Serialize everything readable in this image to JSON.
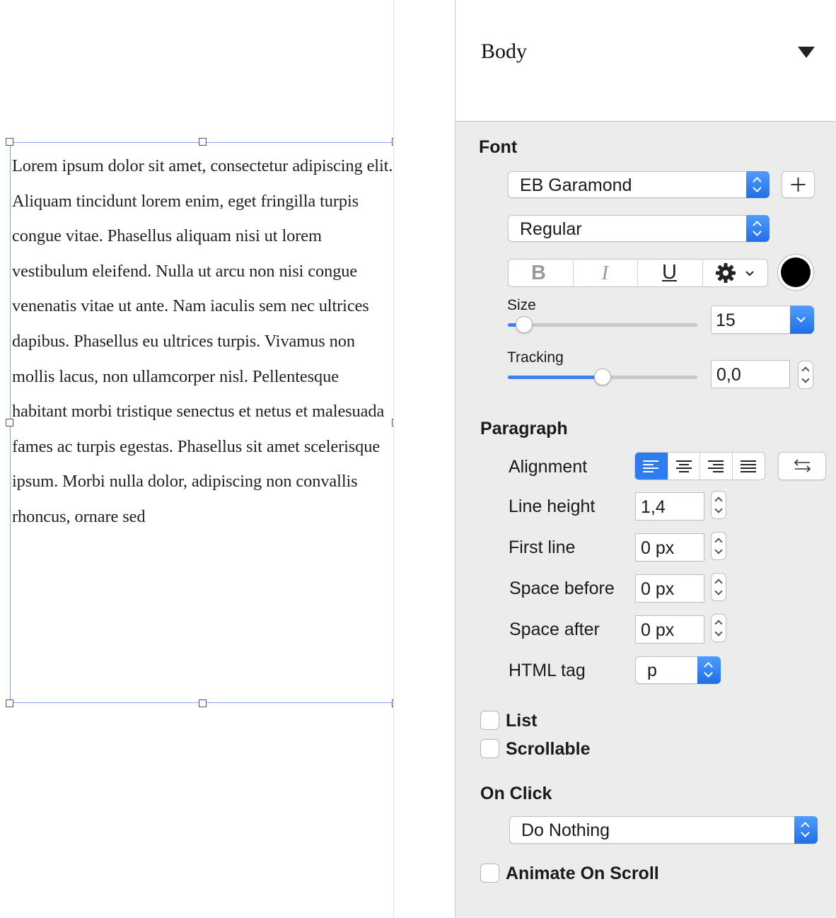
{
  "canvas": {
    "text": "Lorem ipsum dolor sit amet, consectetur adipiscing elit. Aliquam tincidunt lorem enim, eget fringilla turpis congue vitae. Phasellus aliquam nisi ut lorem vestibulum eleifend. Nulla ut arcu non nisi congue venenatis vitae ut ante. Nam iaculis sem nec ultrices dapibus. Phasellus eu ultrices turpis. Vivamus non mollis lacus, non ullamcorper nisl. Pellentesque habitant morbi tristique senectus et netus et malesuada fames ac turpis egestas. Phasellus sit amet scelerisque ipsum. Morbi nulla dolor, adipiscing non convallis rhoncus, ornare sed"
  },
  "inspector": {
    "style_name": "Body",
    "font": {
      "title": "Font",
      "family": "EB Garamond",
      "weight": "Regular",
      "bold_label": "B",
      "italic_label": "I",
      "underline_label": "U",
      "color": "#000000",
      "size_label": "Size",
      "size_value": "15",
      "size_slider_fraction": 0.09,
      "tracking_label": "Tracking",
      "tracking_value": "0,0",
      "tracking_slider_fraction": 0.5
    },
    "paragraph": {
      "title": "Paragraph",
      "alignment_label": "Alignment",
      "alignment_selected": "left",
      "line_height_label": "Line height",
      "line_height_value": "1,4",
      "first_line_label": "First line",
      "first_line_value": "0 px",
      "space_before_label": "Space before",
      "space_before_value": "0 px",
      "space_after_label": "Space after",
      "space_after_value": "0 px",
      "html_tag_label": "HTML tag",
      "html_tag_value": "p"
    },
    "list_label": "List",
    "list_checked": false,
    "scrollable_label": "Scrollable",
    "scrollable_checked": false,
    "on_click": {
      "title": "On Click",
      "action": "Do Nothing"
    },
    "animate_label": "Animate On Scroll",
    "animate_checked": false
  },
  "colors": {
    "accent": "#1f6fe8",
    "selection_border": "#8aa6e3",
    "panel_bg": "#ececec"
  }
}
